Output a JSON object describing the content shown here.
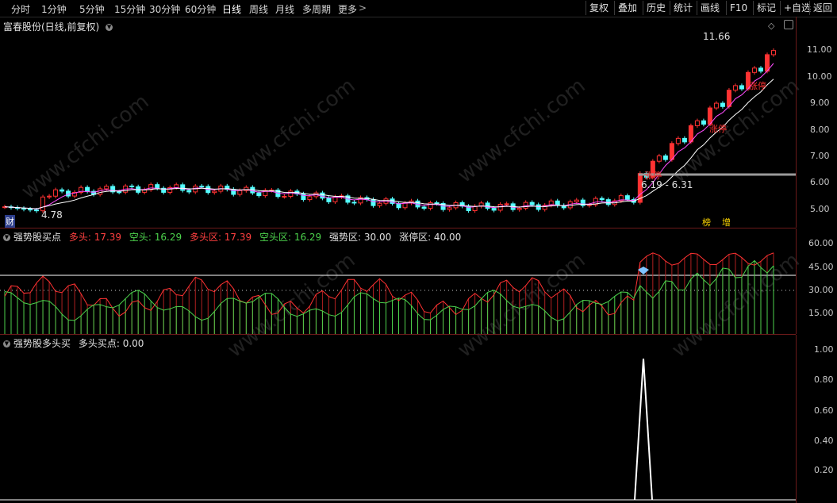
{
  "toolbar": {
    "periods": [
      "分时",
      "1分钟",
      "5分钟",
      "15分钟",
      "30分钟",
      "60分钟",
      "日线",
      "周线",
      "月线",
      "多周期",
      "更多"
    ],
    "buttons": [
      "复权",
      "叠加",
      "历史",
      "统计",
      "画线",
      "F10",
      "标记",
      "+自选",
      "返回"
    ]
  },
  "main": {
    "title": "富春股份(日线,前复权)",
    "high_label": "11.66",
    "low_label": "4.78",
    "range_label": "6.19 - 6.31",
    "marker_cai": "财",
    "marker_bang": "榜",
    "marker_zeng": "增",
    "zt1": "涨停",
    "zt2": "涨停",
    "zt3": "涨停",
    "yticks": [
      "11.00",
      "10.00",
      "9.00",
      "8.00",
      "7.00",
      "6.00",
      "5.00"
    ]
  },
  "ind1": {
    "title": "强势股买点",
    "duo": "多头: 17.39",
    "kong": "空头: 16.29",
    "duoqu": "多头区: 17.39",
    "kongqu": "空头区: 16.29",
    "qsq": "强势区: 30.00",
    "ztq": "涨停区: 40.00",
    "yticks": [
      "60.00",
      "45.00",
      "30.00",
      "15.00"
    ]
  },
  "ind2": {
    "title": "强势股多头买",
    "value": "多头买点: 0.00",
    "yticks": [
      "1.00",
      "0.80",
      "0.60",
      "0.40",
      "0.20"
    ]
  },
  "colors": {
    "up": "#ff3232",
    "down": "#54ffff",
    "green": "#4cd24c",
    "ma": "#ff4cff",
    "yellow": "#ffd700"
  }
}
